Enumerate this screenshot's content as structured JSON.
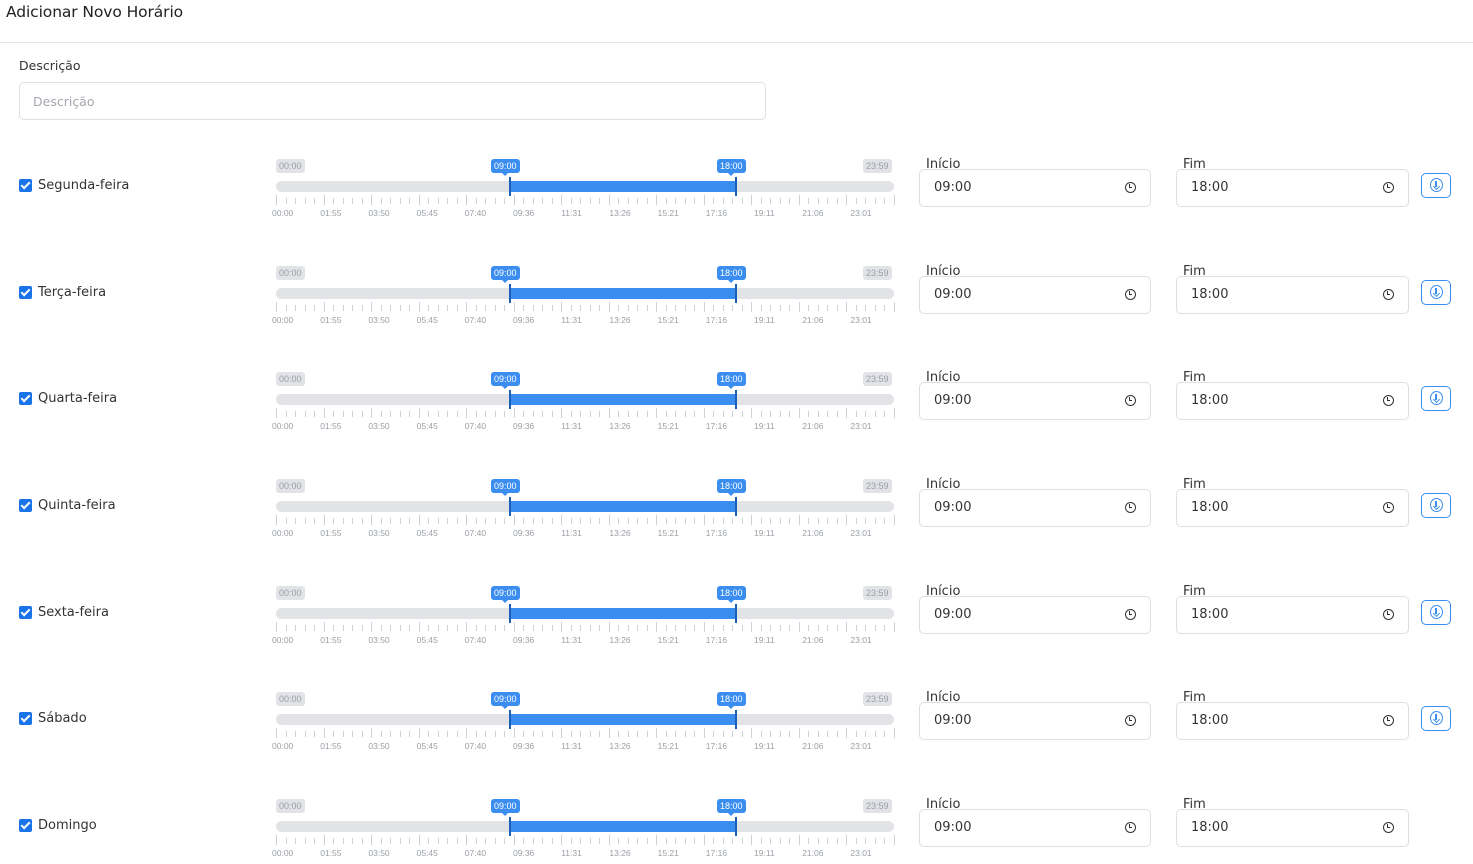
{
  "header": {
    "title": "Adicionar Novo Horário"
  },
  "description": {
    "label": "Descrição",
    "placeholder": "Descrição",
    "value": ""
  },
  "slider": {
    "min_label": "00:00",
    "max_label": "23:59",
    "tick_labels": [
      "00:00",
      "01:55",
      "03:50",
      "05:45",
      "07:40",
      "09:36",
      "11:31",
      "13:26",
      "15:21",
      "17:16",
      "19:11",
      "21:06",
      "23:01"
    ]
  },
  "field_labels": {
    "start": "Início",
    "end": "Fim"
  },
  "accent_color": "#3b8ef0",
  "days": [
    {
      "label": "Segunda-feira",
      "checked": true,
      "start": "09:00",
      "end": "18:00",
      "has_copy_button": true
    },
    {
      "label": "Terça-feira",
      "checked": true,
      "start": "09:00",
      "end": "18:00",
      "has_copy_button": true
    },
    {
      "label": "Quarta-feira",
      "checked": true,
      "start": "09:00",
      "end": "18:00",
      "has_copy_button": true
    },
    {
      "label": "Quinta-feira",
      "checked": true,
      "start": "09:00",
      "end": "18:00",
      "has_copy_button": true
    },
    {
      "label": "Sexta-feira",
      "checked": true,
      "start": "09:00",
      "end": "18:00",
      "has_copy_button": true
    },
    {
      "label": "Sábado",
      "checked": true,
      "start": "09:00",
      "end": "18:00",
      "has_copy_button": true
    },
    {
      "label": "Domingo",
      "checked": true,
      "start": "09:00",
      "end": "18:00",
      "has_copy_button": false
    }
  ]
}
